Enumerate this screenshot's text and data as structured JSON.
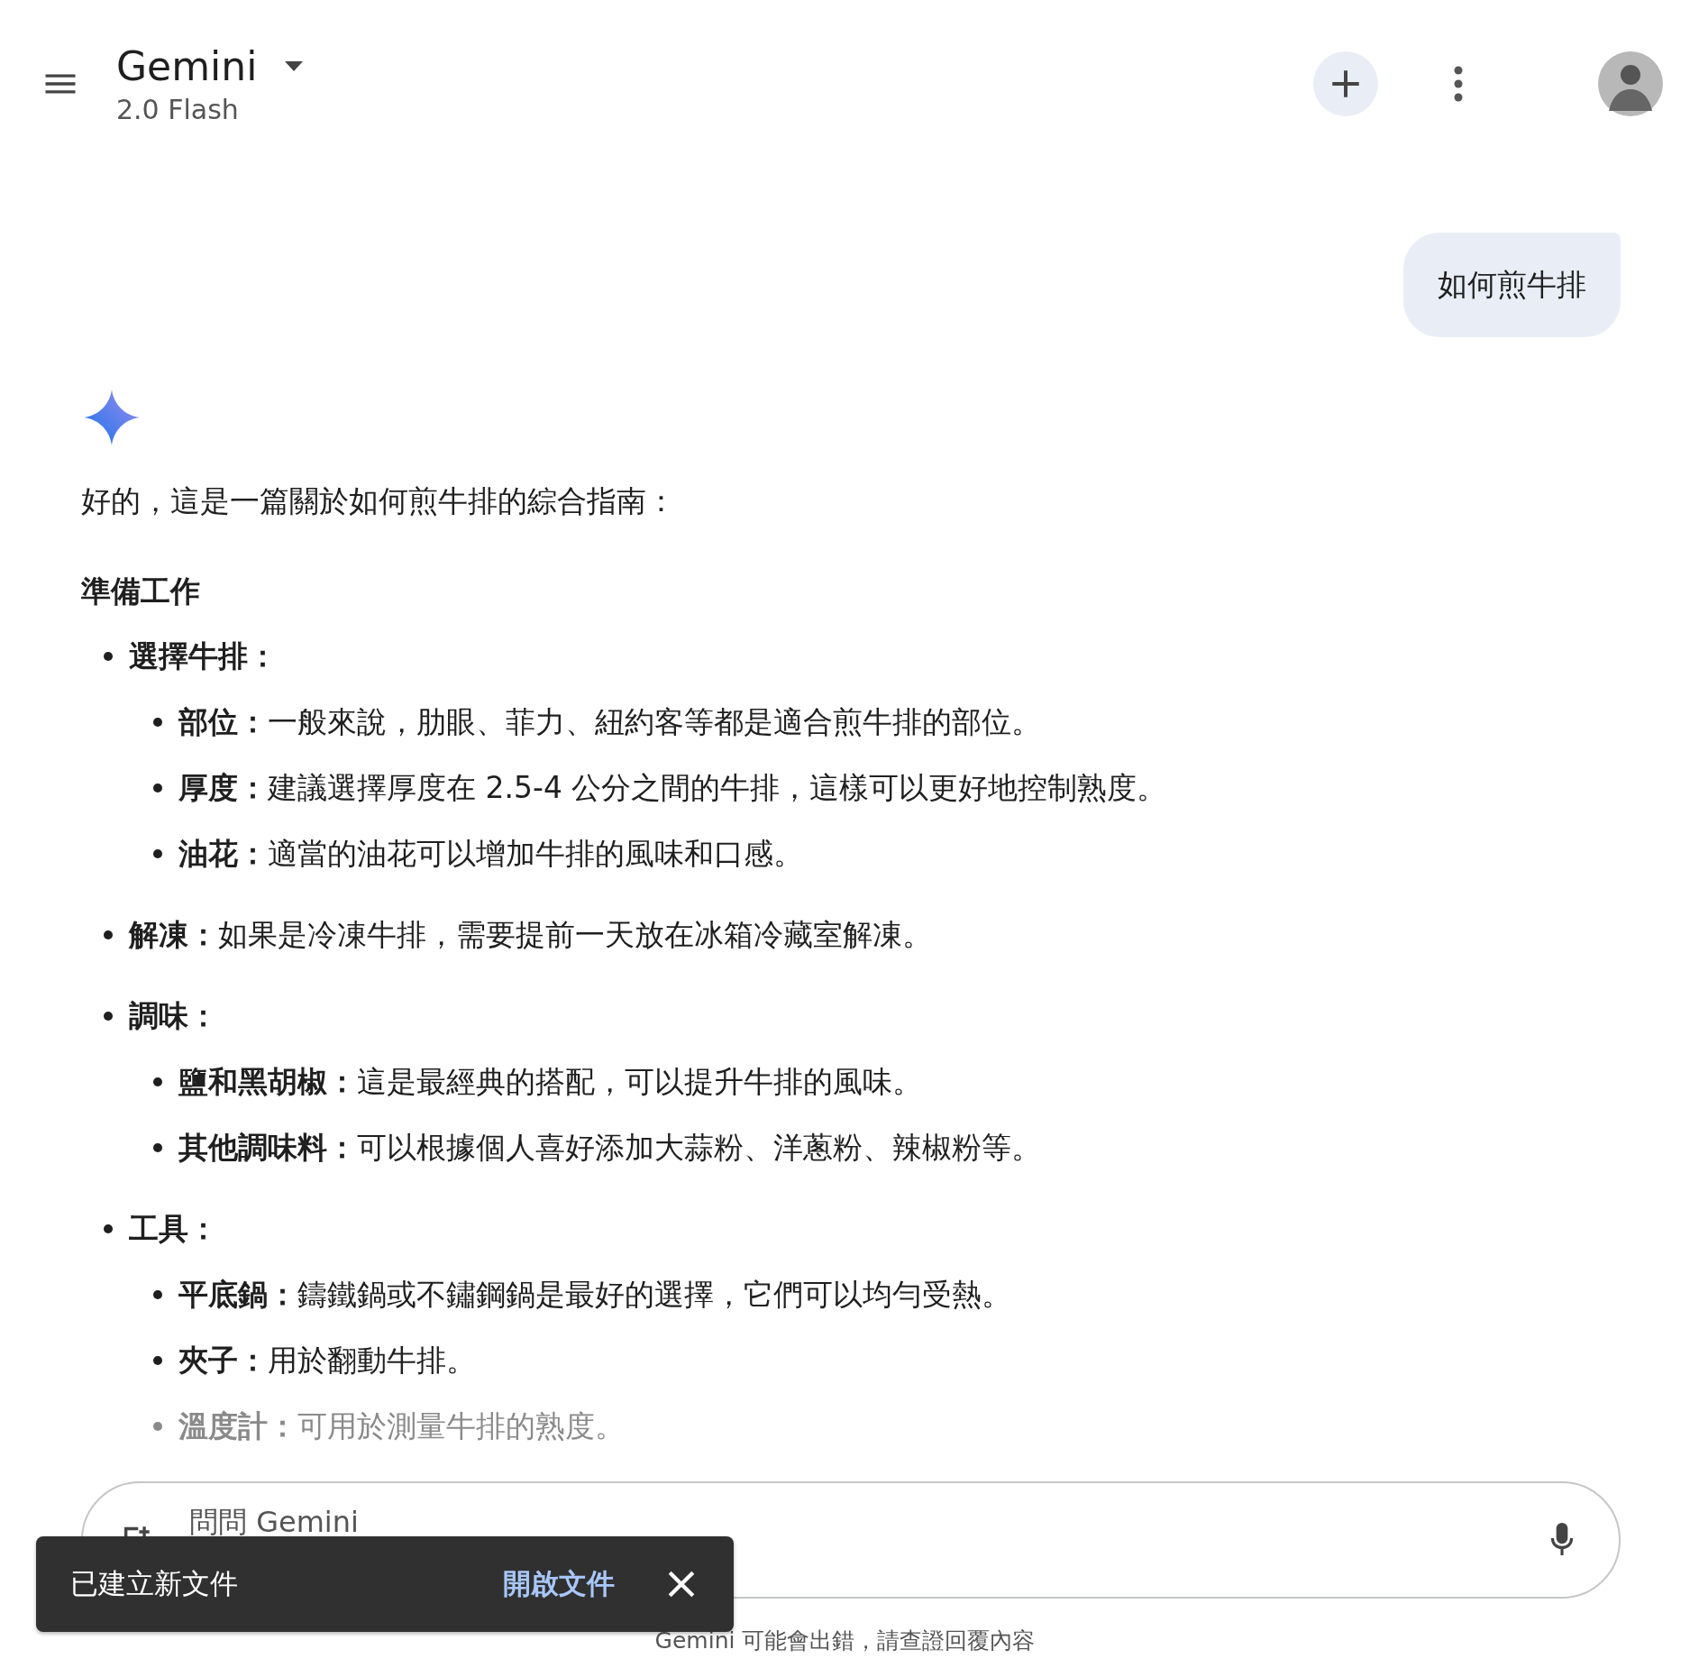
{
  "header": {
    "title": "Gemini",
    "subtitle": "2.0 Flash"
  },
  "user_message": "如何煎牛排",
  "response": {
    "intro": "好的，這是一篇關於如何煎牛排的綜合指南：",
    "heading": "準備工作",
    "items": [
      {
        "label": "選擇牛排：",
        "faded": false,
        "children": [
          {
            "label": "部位：",
            "text": "一般來說，肋眼、菲力、紐約客等都是適合煎牛排的部位。",
            "faded": false
          },
          {
            "label": "厚度：",
            "text": "建議選擇厚度在 2.5-4 公分之間的牛排，這樣可以更好地控制熟度。",
            "faded": false
          },
          {
            "label": "油花：",
            "text": "適當的油花可以增加牛排的風味和口感。",
            "faded": false
          }
        ]
      },
      {
        "label": "解凍：",
        "text": "如果是冷凍牛排，需要提前一天放在冰箱冷藏室解凍。",
        "faded": false
      },
      {
        "label": "調味：",
        "faded": false,
        "children": [
          {
            "label": "鹽和黑胡椒：",
            "text": "這是最經典的搭配，可以提升牛排的風味。",
            "faded": false
          },
          {
            "label": "其他調味料：",
            "text": "可以根據個人喜好添加大蒜粉、洋蔥粉、辣椒粉等。",
            "faded": false
          }
        ]
      },
      {
        "label": "工具：",
        "faded": false,
        "children": [
          {
            "label": "平底鍋：",
            "text": "鑄鐵鍋或不鏽鋼鍋是最好的選擇，它們可以均勻受熱。",
            "faded": false
          },
          {
            "label": "夾子：",
            "text": "用於翻動牛排。",
            "faded": false
          },
          {
            "label": "溫度計：",
            "text": "可用於測量牛排的熟度。",
            "faded": true
          }
        ]
      }
    ]
  },
  "input": {
    "placeholder": "問問 Gemini"
  },
  "toast": {
    "message": "已建立新文件",
    "action": "開啟文件"
  },
  "disclaimer": "Gemini 可能會出錯，請查證回覆內容"
}
